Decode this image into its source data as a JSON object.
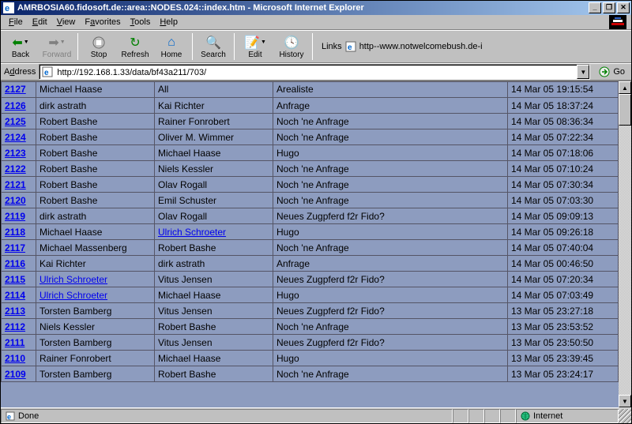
{
  "window": {
    "title": "AMRBOSIA60.fidosoft.de::area::NODES.024::index.htm - Microsoft Internet Explorer"
  },
  "menu": {
    "file": "File",
    "edit": "Edit",
    "view": "View",
    "favorites": "Favorites",
    "tools": "Tools",
    "help": "Help"
  },
  "toolbar": {
    "back": "Back",
    "forward": "Forward",
    "stop": "Stop",
    "refresh": "Refresh",
    "home": "Home",
    "search": "Search",
    "edit": "Edit",
    "history": "History"
  },
  "links": {
    "label": "Links",
    "item1": "http--www.notwelcomebush.de-i"
  },
  "address": {
    "label": "Address",
    "url": "http://192.168.1.33/data/bf43a211/703/",
    "go": "Go"
  },
  "status": {
    "done": "Done",
    "zone": "Internet"
  },
  "rows": [
    {
      "id": "2127",
      "from": "Michael Haase",
      "to": "All",
      "subj": "Arealiste",
      "date": "14 Mar 05 19:15:54",
      "fromLink": false,
      "toLink": false,
      "cut": true
    },
    {
      "id": "2126",
      "from": "dirk astrath",
      "to": "Kai Richter",
      "subj": "Anfrage",
      "date": "14 Mar 05 18:37:24",
      "fromLink": false,
      "toLink": false
    },
    {
      "id": "2125",
      "from": "Robert Bashe",
      "to": "Rainer Fonrobert",
      "subj": "Noch 'ne Anfrage",
      "date": "14 Mar 05 08:36:34",
      "fromLink": false,
      "toLink": false
    },
    {
      "id": "2124",
      "from": "Robert Bashe",
      "to": "Oliver M. Wimmer",
      "subj": "Noch 'ne Anfrage",
      "date": "14 Mar 05 07:22:34",
      "fromLink": false,
      "toLink": false
    },
    {
      "id": "2123",
      "from": "Robert Bashe",
      "to": "Michael Haase",
      "subj": "Hugo",
      "date": "14 Mar 05 07:18:06",
      "fromLink": false,
      "toLink": false
    },
    {
      "id": "2122",
      "from": "Robert Bashe",
      "to": "Niels Kessler",
      "subj": "Noch 'ne Anfrage",
      "date": "14 Mar 05 07:10:24",
      "fromLink": false,
      "toLink": false
    },
    {
      "id": "2121",
      "from": "Robert Bashe",
      "to": "Olav Rogall",
      "subj": "Noch 'ne Anfrage",
      "date": "14 Mar 05 07:30:34",
      "fromLink": false,
      "toLink": false
    },
    {
      "id": "2120",
      "from": "Robert Bashe",
      "to": "Emil Schuster",
      "subj": "Noch 'ne Anfrage",
      "date": "14 Mar 05 07:03:30",
      "fromLink": false,
      "toLink": false
    },
    {
      "id": "2119",
      "from": "dirk astrath",
      "to": "Olav Rogall",
      "subj": "Neues Zugpferd f2r Fido?",
      "date": "14 Mar 05 09:09:13",
      "fromLink": false,
      "toLink": false
    },
    {
      "id": "2118",
      "from": "Michael Haase",
      "to": "Ulrich Schroeter",
      "subj": "Hugo",
      "date": "14 Mar 05 09:26:18",
      "fromLink": false,
      "toLink": true
    },
    {
      "id": "2117",
      "from": "Michael Massenberg",
      "to": "Robert Bashe",
      "subj": "Noch 'ne Anfrage",
      "date": "14 Mar 05 07:40:04",
      "fromLink": false,
      "toLink": false
    },
    {
      "id": "2116",
      "from": "Kai Richter",
      "to": "dirk astrath",
      "subj": "Anfrage",
      "date": "14 Mar 05 00:46:50",
      "fromLink": false,
      "toLink": false
    },
    {
      "id": "2115",
      "from": "Ulrich Schroeter",
      "to": "Vitus Jensen",
      "subj": "Neues Zugpferd f2r Fido?",
      "date": "14 Mar 05 07:20:34",
      "fromLink": true,
      "toLink": false
    },
    {
      "id": "2114",
      "from": "Ulrich Schroeter",
      "to": "Michael Haase",
      "subj": "Hugo",
      "date": "14 Mar 05 07:03:49",
      "fromLink": true,
      "toLink": false
    },
    {
      "id": "2113",
      "from": "Torsten Bamberg",
      "to": "Vitus Jensen",
      "subj": "Neues Zugpferd f2r Fido?",
      "date": "13 Mar 05 23:27:18",
      "fromLink": false,
      "toLink": false
    },
    {
      "id": "2112",
      "from": "Niels Kessler",
      "to": "Robert Bashe",
      "subj": "Noch 'ne Anfrage",
      "date": "13 Mar 05 23:53:52",
      "fromLink": false,
      "toLink": false
    },
    {
      "id": "2111",
      "from": "Torsten Bamberg",
      "to": "Vitus Jensen",
      "subj": "Neues Zugpferd f2r Fido?",
      "date": "13 Mar 05 23:50:50",
      "fromLink": false,
      "toLink": false
    },
    {
      "id": "2110",
      "from": "Rainer Fonrobert",
      "to": "Michael Haase",
      "subj": "Hugo",
      "date": "13 Mar 05 23:39:45",
      "fromLink": false,
      "toLink": false
    },
    {
      "id": "2109",
      "from": "Torsten Bamberg",
      "to": "Robert Bashe",
      "subj": "Noch 'ne Anfrage",
      "date": "13 Mar 05 23:24:17",
      "fromLink": false,
      "toLink": false,
      "cut": true
    }
  ]
}
